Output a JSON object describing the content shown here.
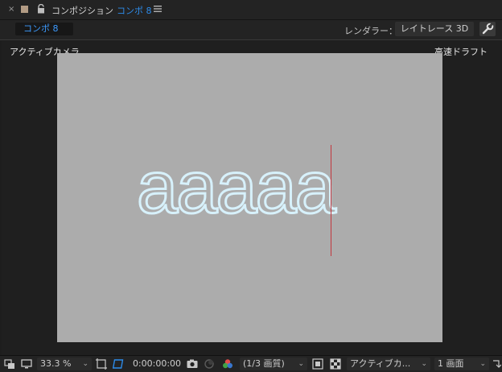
{
  "titlebar": {
    "close": "×",
    "panel_name": "コンポジション",
    "comp_name": "コンポ 8",
    "swatch_color": "#b29b84"
  },
  "tabbar": {
    "active_tab": "コンポ 8",
    "renderer_label": "レンダラー：",
    "renderer_value": "レイトレース 3D"
  },
  "viewer": {
    "view_label": "アクティブカメラ",
    "quality_label": "高速ドラフト",
    "canvas_color": "#acacac",
    "text_layer": "aaaaa"
  },
  "toolbar": {
    "zoom": "33.3 %",
    "timecode": "0:00:00:00",
    "resolution": "(1/3 画質)",
    "camera_view": "アクティブカ...",
    "view_layout": "1 画面"
  },
  "colors": {
    "accent": "#2d8ceb",
    "cursor": "#c2373e"
  }
}
